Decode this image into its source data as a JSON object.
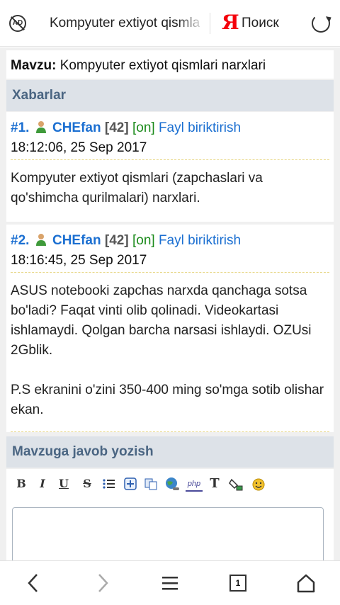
{
  "browser": {
    "url_text": "Kompyuter extiyot qismlari narxlari",
    "adblock_label": "AD",
    "yandex_logo": "Я",
    "search_label": "Поиск",
    "tab_count": "1"
  },
  "topic": {
    "label": "Mavzu:",
    "title": "Kompyuter extiyot qismlari narxlari"
  },
  "messages_header": "Xabarlar",
  "posts": [
    {
      "number": "#1.",
      "user": "CHEfan",
      "rep": "[42]",
      "status": "[on]",
      "attach_link": "Fayl biriktirish",
      "time": "18:12:06, 25 Sep 2017",
      "body": "Kompyuter extiyot qismlari (zapchaslari va qo'shimcha qurilmalari) narxlari."
    },
    {
      "number": "#2.",
      "user": "CHEfan",
      "rep": "[42]",
      "status": "[on]",
      "attach_link": "Fayl biriktirish",
      "time": "18:16:45, 25 Sep 2017",
      "body_p1": "ASUS notebooki zapchas narxda qanchaga sotsa bo'ladi? Faqat vinti olib qolinadi. Videokartasi ishlamaydi. Qolgan barcha narsasi ishlaydi. OZUsi 2Gblik.",
      "body_p2": "P.S ekranini o'zini 350-400 ming so'mga sotib olishar ekan."
    }
  ],
  "reply": {
    "header": "Mavzuga javob yozish",
    "toolbar": {
      "bold": "B",
      "italic": "I",
      "underline": "U",
      "strike": "S",
      "php": "php",
      "text": "T"
    }
  },
  "colors": {
    "link": "#1b6fd1",
    "online": "#1a8a1a",
    "section_bg": "#dde2e8",
    "section_text": "#4a6582"
  }
}
